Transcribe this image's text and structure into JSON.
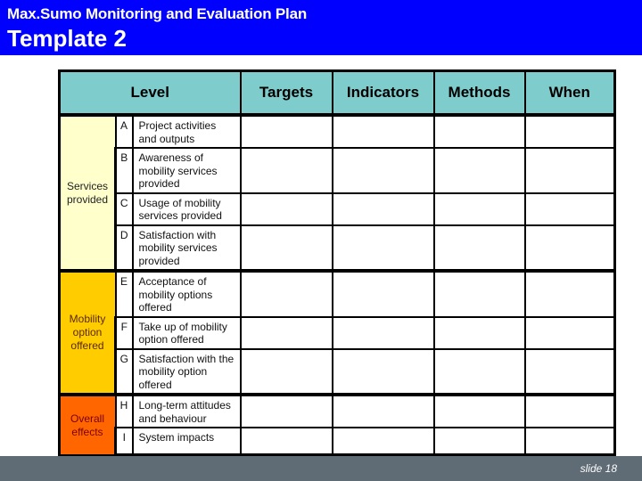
{
  "header": {
    "subtitle": "Max.Sumo Monitoring and Evaluation Plan",
    "title": "Template 2",
    "background_color": "#0000ff"
  },
  "table": {
    "columns": {
      "level": "Level",
      "targets": "Targets",
      "indicators": "Indicators",
      "methods": "Methods",
      "when": "When"
    },
    "header_color": "#7fcccc",
    "groups": [
      {
        "label": "Services provided",
        "color": "#ffffcc",
        "rows": [
          {
            "letter": "A",
            "description": "Project activities and outputs",
            "targets": "",
            "indicators": "",
            "methods": "",
            "when": ""
          },
          {
            "letter": "B",
            "description": "Awareness of mobility services provided",
            "targets": "",
            "indicators": "",
            "methods": "",
            "when": ""
          },
          {
            "letter": "C",
            "description": "Usage of mobility services provided",
            "targets": "",
            "indicators": "",
            "methods": "",
            "when": ""
          },
          {
            "letter": "D",
            "description": "Satisfaction with mobility services provided",
            "targets": "",
            "indicators": "",
            "methods": "",
            "when": ""
          }
        ]
      },
      {
        "label": "Mobility option offered",
        "color": "#ffcc00",
        "rows": [
          {
            "letter": "E",
            "description": "Acceptance of mobility options offered",
            "targets": "",
            "indicators": "",
            "methods": "",
            "when": ""
          },
          {
            "letter": "F",
            "description": "Take up of mobility option offered",
            "targets": "",
            "indicators": "",
            "methods": "",
            "when": ""
          },
          {
            "letter": "G",
            "description": "Satisfaction with the mobility option offered",
            "targets": "",
            "indicators": "",
            "methods": "",
            "when": ""
          }
        ]
      },
      {
        "label": "Overall effects",
        "color": "#ff6600",
        "rows": [
          {
            "letter": "H",
            "description": "Long-term attitudes and behaviour",
            "targets": "",
            "indicators": "",
            "methods": "",
            "when": ""
          },
          {
            "letter": "I",
            "description": "System impacts",
            "targets": "",
            "indicators": "",
            "methods": "",
            "when": ""
          }
        ]
      }
    ]
  },
  "footer": {
    "slide_label": "slide 18",
    "background_color": "#5f6b75"
  }
}
